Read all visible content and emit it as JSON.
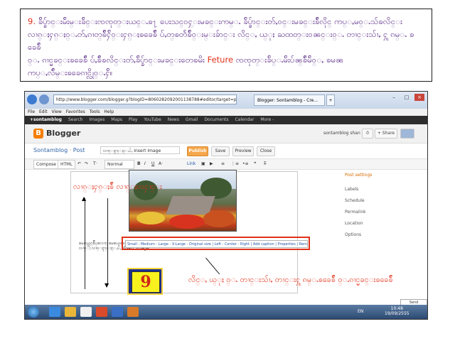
{
  "note": {
    "number": "9.",
    "line1": "ခ်ိပ္ခ်ာင္းမ်ိးမ္းခ်ိင္းၸၸုတ္းယင္ႉၶ႑ ပေးသင္ဝႁ္းမခင္းကမ္ႉ ခ်ိပ္ခ်ာင္းတ်ႇဝင္းမခင္းၶ်ိဴလိုင္ ကပ္ႇမဝ္ႉသ်ၶလိင္း",
    "line2": "လၢၵ္ႈႁၵ္ႈဝ္ႉတ်ႇၵၢတ္ၶ်ိဴႁ်ိဝ္းႁၵ္ႈၶခေၶ်ိဴ ပ်ႇတ္ၶတႅၶ်ိဴဝ္းမ္းခ်ာင္း လိင္ႇ ယ္ုႈ ႀထတ္းဝၼင္းဝ္ႉ တၢင္းသ်ၢႇ ႁူ ၵမ္ႉ ၶခေၶ်ိဴ",
    "line3": "ဝ္ႉ ၵၢင္မခင္းၶခေၶ်ိဴ ပ်ႇၶ်ိဴၶလိင္းတ်ႇခ်ိပ္ခ်ာင္းမခင္းတေၶမိး",
    "highlight": "Feture",
    "line3b": "ၸၸုတ္းခ်ိပ္ႉမ်ိးပ်ၼ္ၶ်ိဴမ်ိဝ္ႇ ၶမၼ",
    "line4": "ကပ္ႇလ်ိဴမ္းၶခေၵၢင္လိုဝ္ႉႁ်ိ။"
  },
  "browser": {
    "address": "http://www.blogger.com/blogger.g?blogID=8060282092001138788#editor/target=po",
    "tab_label": "Blogger: Sontamblog - Cre...",
    "menu": [
      "File",
      "Edit",
      "View",
      "Favorites",
      "Tools",
      "Help"
    ],
    "google_bar": [
      "+sontamblog",
      "Search",
      "Images",
      "Maps",
      "Play",
      "YouTube",
      "News",
      "Gmail",
      "Documents",
      "Calendar",
      "More -"
    ]
  },
  "blogger": {
    "logo_letter": "B",
    "title": "Blogger",
    "user": "sontamblog shan",
    "share_count": "0",
    "share_label": "+ Share",
    "blog_name": "Sontamblog",
    "crumb": "Post",
    "post_title": "လၢၵ္ႈႁၵ္ႈဝ္ႉပ်ႇ Insert Image",
    "buttons": {
      "publish": "Publish",
      "save": "Save",
      "preview": "Preview",
      "close": "Close"
    },
    "tabs": {
      "compose": "Compose",
      "html": "HTML"
    },
    "font": "Normal",
    "sidebar": {
      "heading": "Post settings",
      "items": [
        "Labels",
        "Schedule",
        "Permalink",
        "Location",
        "Options"
      ]
    },
    "image_bar": "Small - Medium - Large - X-Large - Original size | Left - Center - Right | Add caption | Properties | Remove",
    "editor_text": "ၶမၶယ္သင္ၶ်ိဴပ္ၶလၢင္ ၶမၶယ္ၼႁူပ္ဝ္ႇ Blog ၶတိ Post ၶလၢၵ္ႈ လၢၵ္ႈႁၵ္ႈဝ္ႉပ်ႇ Insert Image",
    "feedback": "Send feedback"
  },
  "annotations": {
    "left": "လၢၵ္ႈႁၵ္ႈၶ်ိဴ လၢၵ္ႈလႁၢင္း",
    "right": "လိင္ႇ ယ္ုႈ ဝ္ႉ တၢင္းသ်ၢႇ တၢင္းႁူ ၵမ္ႉၶခေၶ်ိဴ ဝ္ႉၵၢင္မခင္းၶခေၶ်ိဴ",
    "badge": "9"
  },
  "taskbar": {
    "lang": "EN",
    "time": "10:48",
    "date": "19/09/2555"
  }
}
